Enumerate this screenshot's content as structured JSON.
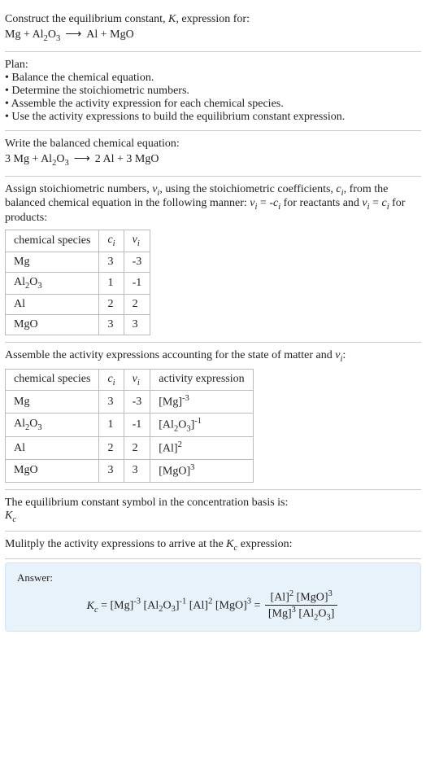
{
  "intro": {
    "line1": "Construct the equilibrium constant, K, expression for:",
    "equation": "Mg + Al₂O₃  ⟶  Al + MgO"
  },
  "plan": {
    "title": "Plan:",
    "b1": "• Balance the chemical equation.",
    "b2": "• Determine the stoichiometric numbers.",
    "b3": "• Assemble the activity expression for each chemical species.",
    "b4": "• Use the activity expressions to build the equilibrium constant expression."
  },
  "balanced": {
    "title": "Write the balanced chemical equation:",
    "equation": "3 Mg + Al₂O₃  ⟶  2 Al + 3 MgO"
  },
  "assign": {
    "text1": "Assign stoichiometric numbers, νᵢ, using the stoichiometric coefficients, cᵢ, from the balanced chemical equation in the following manner: νᵢ = -cᵢ for reactants and νᵢ = cᵢ for products:",
    "h1": "chemical species",
    "h2": "cᵢ",
    "h3": "νᵢ",
    "rows": [
      {
        "sp": "Mg",
        "c": "3",
        "v": "-3"
      },
      {
        "sp": "Al₂O₃",
        "c": "1",
        "v": "-1"
      },
      {
        "sp": "Al",
        "c": "2",
        "v": "2"
      },
      {
        "sp": "MgO",
        "c": "3",
        "v": "3"
      }
    ]
  },
  "activity": {
    "text": "Assemble the activity expressions accounting for the state of matter and νᵢ:",
    "h1": "chemical species",
    "h2": "cᵢ",
    "h3": "νᵢ",
    "h4": "activity expression",
    "rows": [
      {
        "sp": "Mg",
        "c": "3",
        "v": "-3",
        "a": "[Mg]⁻³"
      },
      {
        "sp": "Al₂O₃",
        "c": "1",
        "v": "-1",
        "a": "[Al₂O₃]⁻¹"
      },
      {
        "sp": "Al",
        "c": "2",
        "v": "2",
        "a": "[Al]²"
      },
      {
        "sp": "MgO",
        "c": "3",
        "v": "3",
        "a": "[MgO]³"
      }
    ]
  },
  "symbol": {
    "text": "The equilibrium constant symbol in the concentration basis is:",
    "sym": "K_c"
  },
  "multiply": {
    "text": "Mulitply the activity expressions to arrive at the K_c expression:"
  },
  "answer": {
    "label": "Answer:",
    "lhs": "K_c = [Mg]⁻³ [Al₂O₃]⁻¹ [Al]² [MgO]³ = ",
    "num": "[Al]² [MgO]³",
    "den": "[Mg]³ [Al₂O₃]"
  },
  "chart_data": {
    "type": "table",
    "tables": [
      {
        "columns": [
          "chemical species",
          "cᵢ",
          "νᵢ"
        ],
        "rows": [
          [
            "Mg",
            3,
            -3
          ],
          [
            "Al₂O₃",
            1,
            -1
          ],
          [
            "Al",
            2,
            2
          ],
          [
            "MgO",
            3,
            3
          ]
        ]
      },
      {
        "columns": [
          "chemical species",
          "cᵢ",
          "νᵢ",
          "activity expression"
        ],
        "rows": [
          [
            "Mg",
            3,
            -3,
            "[Mg]^-3"
          ],
          [
            "Al₂O₃",
            1,
            -1,
            "[Al₂O₃]^-1"
          ],
          [
            "Al",
            2,
            2,
            "[Al]^2"
          ],
          [
            "MgO",
            3,
            3,
            "[MgO]^3"
          ]
        ]
      }
    ]
  }
}
